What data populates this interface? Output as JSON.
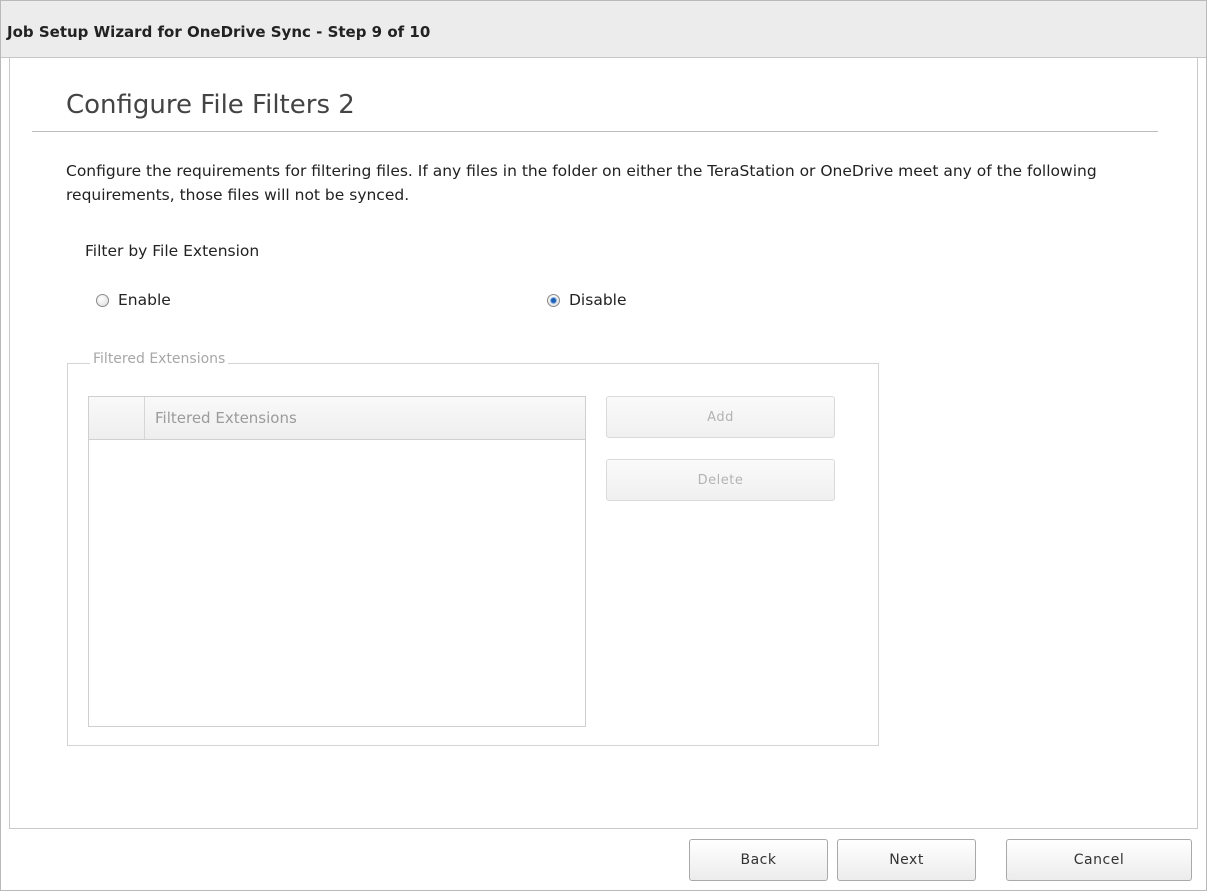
{
  "window": {
    "title": "Job Setup Wizard for OneDrive Sync - Step 9 of 10"
  },
  "page": {
    "heading": "Configure File Filters 2",
    "description": "Configure the requirements for filtering files. If any files in the folder on either the TeraStation or OneDrive meet any of the following requirements, those files will not be synced."
  },
  "filter": {
    "label": "Filter by File Extension",
    "options": [
      {
        "label": "Enable",
        "checked": false
      },
      {
        "label": "Disable",
        "checked": true
      }
    ],
    "selected": "Disable"
  },
  "extensions": {
    "legend": "Filtered Extensions",
    "column_header": "Filtered Extensions",
    "rows": [],
    "add_label": "Add",
    "delete_label": "Delete",
    "disabled": true
  },
  "footer": {
    "back_label": "Back",
    "next_label": "Next",
    "cancel_label": "Cancel"
  },
  "colors": {
    "titlebar_bg": "#ececec",
    "radio_accent": "#1e5fb3",
    "disabled_text": "#b3b3b3"
  }
}
